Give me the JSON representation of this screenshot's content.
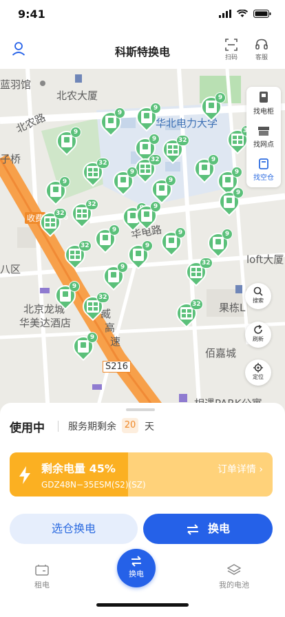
{
  "status_bar": {
    "time": "9:41"
  },
  "header": {
    "title": "科斯特换电",
    "scan_label": "扫码",
    "service_label": "客服"
  },
  "map": {
    "labels": {
      "landan": "蓝羽馆",
      "beinong": "北农大厦",
      "beinonglu": "北农路",
      "huabei": "华北电力大学",
      "ziqiao": "子桥",
      "shoufei": "收费",
      "road16": "16",
      "huadianlu": "华电路",
      "baqu": "八区",
      "loft": "loft大厦",
      "longcheng": "北京龙城",
      "huameida": "华美达酒店",
      "guolin": "果栋L",
      "zang": "臧",
      "gao": "高",
      "su": "速",
      "baijia": "佰嘉城",
      "s216": "S216",
      "xiangyu": "相遇PARK公寓"
    },
    "pins": [
      {
        "badge": "9",
        "multi": false
      },
      {
        "badge": "9",
        "multi": false
      },
      {
        "badge": "9",
        "multi": false
      },
      {
        "badge": "9",
        "multi": false
      },
      {
        "badge": "32",
        "multi": true
      },
      {
        "badge": "9",
        "multi": false
      },
      {
        "badge": "32",
        "multi": true
      },
      {
        "badge": "32",
        "multi": true
      },
      {
        "badge": "9",
        "multi": false
      },
      {
        "badge": "32",
        "multi": true
      },
      {
        "badge": "9",
        "multi": false
      },
      {
        "badge": "9",
        "multi": false
      },
      {
        "badge": "9",
        "multi": false
      },
      {
        "badge": "9",
        "multi": false
      },
      {
        "badge": "9",
        "multi": false
      },
      {
        "badge": "32",
        "multi": true
      },
      {
        "badge": "9",
        "multi": false
      },
      {
        "badge": "9",
        "multi": false
      },
      {
        "badge": "32",
        "multi": true
      },
      {
        "badge": "9",
        "multi": false
      },
      {
        "badge": "32",
        "multi": true
      },
      {
        "badge": "9",
        "multi": false
      },
      {
        "badge": "9",
        "multi": false
      },
      {
        "badge": "32",
        "multi": true
      },
      {
        "badge": "9",
        "multi": false
      },
      {
        "badge": "9",
        "multi": false
      },
      {
        "badge": "32",
        "multi": true
      },
      {
        "badge": "9",
        "multi": false
      },
      {
        "badge": "32",
        "multi": true
      },
      {
        "badge": "9",
        "multi": false
      },
      {
        "badge": "9",
        "multi": false
      },
      {
        "badge": "9",
        "multi": false
      }
    ]
  },
  "side_panel": {
    "find_cabinet": "找电柜",
    "find_outlet": "找网点",
    "find_empty": "找空仓"
  },
  "map_buttons": {
    "search": "搜索",
    "refresh": "刷新",
    "locate": "定位"
  },
  "sheet": {
    "status": "使用中",
    "service_remaining": "服务期剩余",
    "days": "20",
    "days_unit": "天",
    "battery_label": "剩余电量 45%",
    "battery_level": 0.45,
    "battery_model": "GDZ48N−35ESM(S2)(SZ)",
    "order_detail": "订单详情 ›",
    "choose_slot": "选仓换电",
    "swap": "换电"
  },
  "tabbar": {
    "rent": "租电",
    "swap": "换电",
    "my_battery": "我的电池"
  },
  "colors": {
    "primary": "#2561e8",
    "pin_green": "#5bc07a",
    "battery_orange": "#fbb022"
  }
}
